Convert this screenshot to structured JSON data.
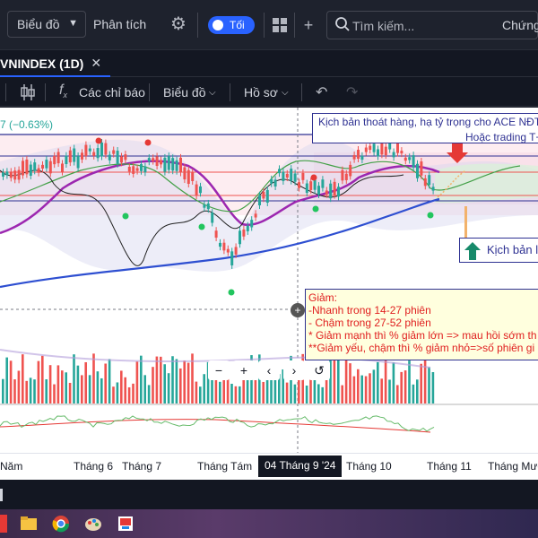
{
  "topbar": {
    "chart_dropdown": "Biểu đồ",
    "analysis": "Phân tích",
    "theme_toggle": "Tối",
    "search_placeholder": "Tìm kiếm...",
    "stocks_label": "Chứng"
  },
  "tab": {
    "title": "VNINDEX (1D)"
  },
  "toolbar": {
    "indicators": "Các chỉ báo",
    "chart_menu": "Biểu đồ",
    "profile_menu": "Hồ sơ"
  },
  "chart": {
    "change_text": "7 (−0.63%)",
    "note_top_line1": "Kịch bản thoát hàng, hạ tỷ trọng cho ACE NĐT",
    "note_top_line2": "Hoặc trading T+",
    "note_right": "Kịch bản lý",
    "warning_lines": [
      "Giảm:",
      "-Nhanh trong 14-27 phiên",
      "- Chậm trong 27-52 phiên",
      "* Giảm mạnh thì % giảm lớn => mau hồi sớm th",
      "**Giảm yếu, chậm thì % giảm nhỏ=>số phiên gi"
    ],
    "zoom_controls": [
      "−",
      "+",
      "‹",
      "›",
      "↺"
    ],
    "colors": {
      "up": "#26a69a",
      "down": "#ef5350",
      "ma": "#9c27b0",
      "trend": "#2e4fd1"
    }
  },
  "time_axis": {
    "ticks": [
      "Năm",
      "Tháng 6",
      "Tháng 7",
      "Tháng Tám",
      "Tháng 10",
      "Tháng 11",
      "Tháng Mười"
    ],
    "cursor_label": "04 Tháng 9 '24"
  }
}
